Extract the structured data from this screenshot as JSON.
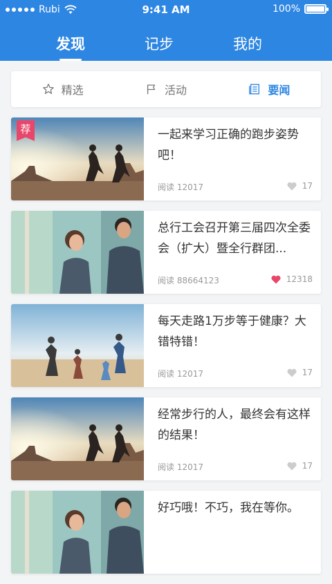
{
  "status_bar": {
    "carrier": "Rubi",
    "time": "9:41 AM",
    "battery": "100%"
  },
  "top_tabs": [
    {
      "label": "发现",
      "active": true
    },
    {
      "label": "记步",
      "active": false
    },
    {
      "label": "我的",
      "active": false
    }
  ],
  "segments": [
    {
      "label": "精选",
      "icon": "star-icon",
      "active": false
    },
    {
      "label": "活动",
      "icon": "flag-icon",
      "active": false
    },
    {
      "label": "要闻",
      "icon": "news-icon",
      "active": true
    }
  ],
  "colors": {
    "brand": "#2d86e2",
    "badge": "#e8476b",
    "heart_liked": "#e8476b",
    "heart_default": "#cccccc"
  },
  "articles": [
    {
      "title": "一起来学习正确的跑步姿势吧！",
      "reads_label": "阅读",
      "reads": "12017",
      "likes": "17",
      "liked": false,
      "badge": "荐",
      "image": "sunset-runners"
    },
    {
      "title": "总行工会召开第三届四次全委会（扩大）暨全行群团...",
      "reads_label": "阅读",
      "reads": "88664123",
      "likes": "12318",
      "liked": true,
      "badge": "",
      "image": "couple-jogging"
    },
    {
      "title": "每天走路1万步等于健康？大错特错！",
      "reads_label": "阅读",
      "reads": "12017",
      "likes": "17",
      "liked": false,
      "badge": "",
      "image": "beach-family"
    },
    {
      "title": "经常步行的人，最终会有这样的结果！",
      "reads_label": "阅读",
      "reads": "12017",
      "likes": "17",
      "liked": false,
      "badge": "",
      "image": "sunset-runners"
    },
    {
      "title": "好巧哦！不巧，我在等你。",
      "reads_label": "",
      "reads": "",
      "likes": "",
      "liked": false,
      "badge": "",
      "image": "couple-jogging"
    }
  ]
}
